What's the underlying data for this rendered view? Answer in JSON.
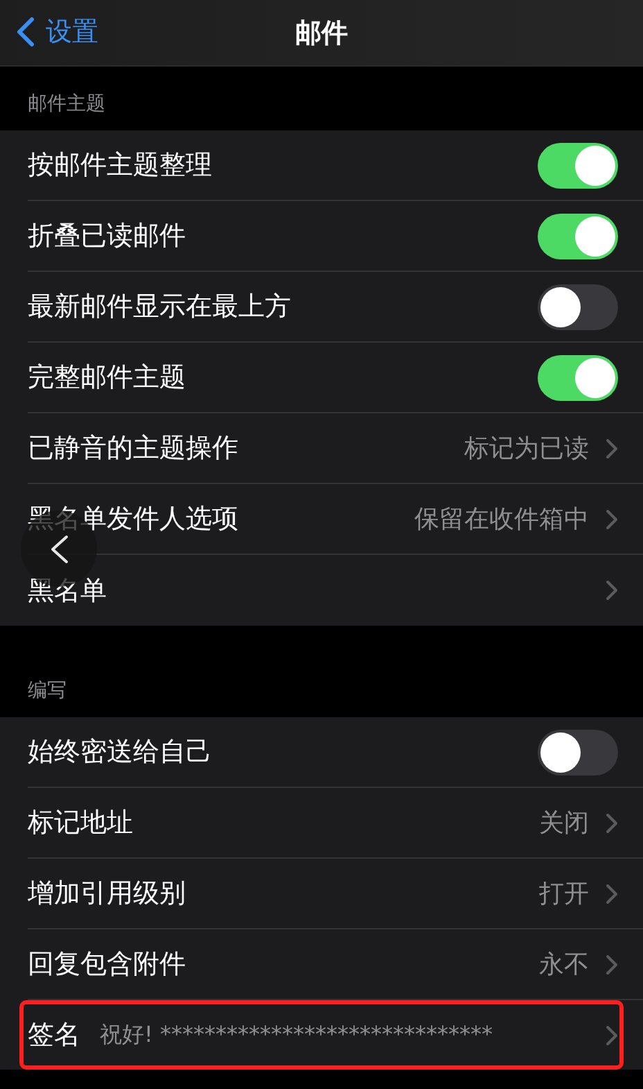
{
  "nav": {
    "back": "设置",
    "title": "邮件"
  },
  "sections": [
    {
      "header": "邮件主题",
      "rows": [
        {
          "kind": "toggle",
          "label": "按邮件主题整理",
          "on": true
        },
        {
          "kind": "toggle",
          "label": "折叠已读邮件",
          "on": true
        },
        {
          "kind": "toggle",
          "label": "最新邮件显示在最上方",
          "on": false
        },
        {
          "kind": "toggle",
          "label": "完整邮件主题",
          "on": true
        },
        {
          "kind": "link",
          "label": "已静音的主题操作",
          "value": "标记为已读"
        },
        {
          "kind": "link",
          "label": "黑名单发件人选项",
          "value": "保留在收件箱中"
        },
        {
          "kind": "link",
          "label": "黑名单"
        }
      ]
    },
    {
      "header": "编写",
      "rows": [
        {
          "kind": "toggle",
          "label": "始终密送给自己",
          "on": false
        },
        {
          "kind": "link",
          "label": "标记地址",
          "value": "关闭"
        },
        {
          "kind": "link",
          "label": "增加引用级别",
          "value": "打开"
        },
        {
          "kind": "link",
          "label": "回复包含附件",
          "value": "永不"
        },
        {
          "kind": "signature",
          "label": "签名",
          "value": "祝好! ******************************",
          "highlighted": true
        }
      ]
    }
  ]
}
